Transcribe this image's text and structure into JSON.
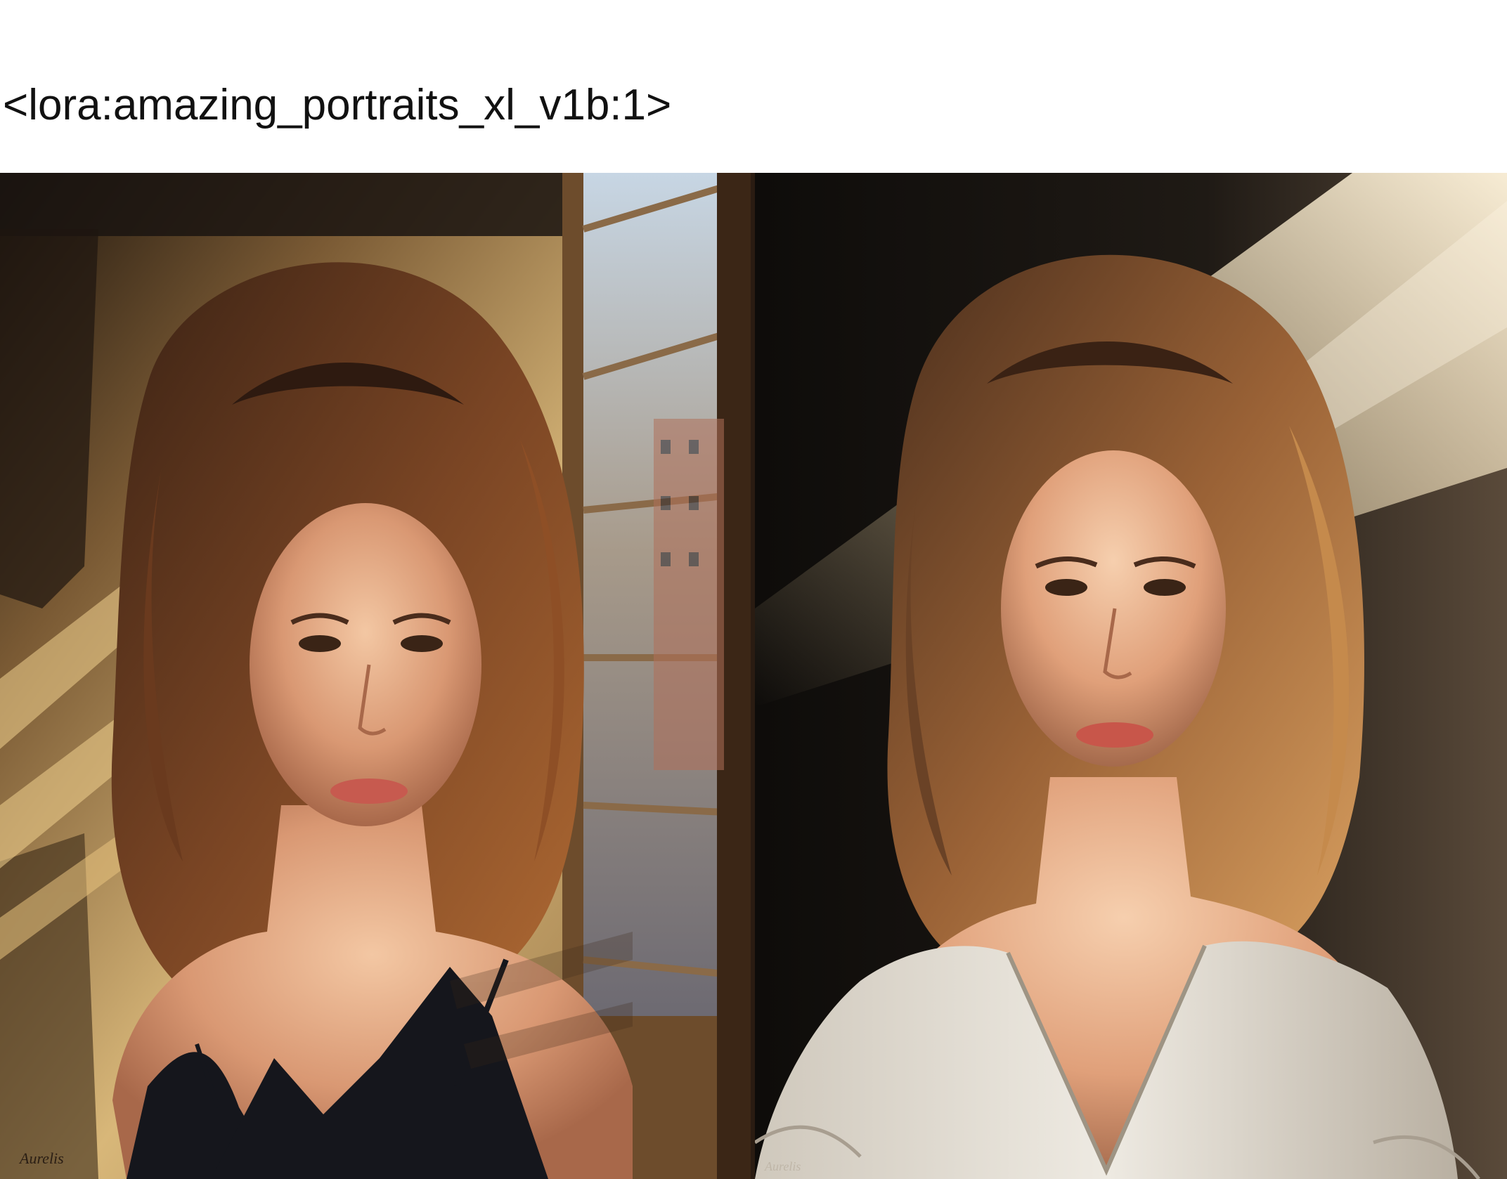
{
  "caption": "<lora:amazing_portraits_xl_v1b:1>",
  "images": [
    {
      "subject": "woman-portrait",
      "signature_icon": "signature-icon",
      "palette": {
        "background": "#c9a46a",
        "wall_shadow": "#3b2a1a",
        "hair": "#6b3f22",
        "skin": "#e8b089",
        "top": "#15161c",
        "window_glass": "#9fb3c8"
      }
    },
    {
      "subject": "woman-portrait",
      "signature_icon": "signature-icon",
      "palette": {
        "background": "#1a1612",
        "light_beam": "#f4e6c8",
        "hair": "#8a5a34",
        "skin": "#e9b592",
        "top": "#e8e2d8"
      }
    }
  ]
}
